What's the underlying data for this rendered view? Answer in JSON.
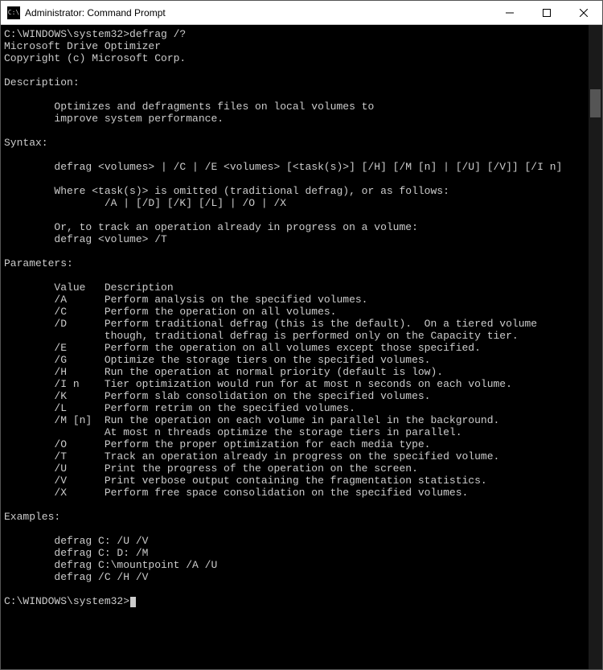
{
  "titlebar": {
    "icon_text": "C:\\",
    "title": "Administrator: Command Prompt"
  },
  "prompt1": "C:\\WINDOWS\\system32>defrag /?",
  "header1": "Microsoft Drive Optimizer",
  "header2": "Copyright (c) Microsoft Corp.",
  "desc_label": "Description:",
  "desc1": "        Optimizes and defragments files on local volumes to",
  "desc2": "        improve system performance.",
  "syntax_label": "Syntax:",
  "syntax1": "        defrag <volumes> | /C | /E <volumes> [<task(s)>] [/H] [/M [n] | [/U] [/V]] [/I n]",
  "syntax2": "        Where <task(s)> is omitted (traditional defrag), or as follows:",
  "syntax3": "                /A | [/D] [/K] [/L] | /O | /X",
  "syntax4": "        Or, to track an operation already in progress on a volume:",
  "syntax5": "        defrag <volume> /T",
  "params_label": "Parameters:",
  "phdr": "        Value   Description",
  "pA": "        /A      Perform analysis on the specified volumes.",
  "pC": "        /C      Perform the operation on all volumes.",
  "pD1": "        /D      Perform traditional defrag (this is the default).  On a tiered volume",
  "pD2": "                though, traditional defrag is performed only on the Capacity tier.",
  "pE": "        /E      Perform the operation on all volumes except those specified.",
  "pG": "        /G      Optimize the storage tiers on the specified volumes.",
  "pH": "        /H      Run the operation at normal priority (default is low).",
  "pIn": "        /I n    Tier optimization would run for at most n seconds on each volume.",
  "pK": "        /K      Perform slab consolidation on the specified volumes.",
  "pL": "        /L      Perform retrim on the specified volumes.",
  "pM1": "        /M [n]  Run the operation on each volume in parallel in the background.",
  "pM2": "                At most n threads optimize the storage tiers in parallel.",
  "pO": "        /O      Perform the proper optimization for each media type.",
  "pT": "        /T      Track an operation already in progress on the specified volume.",
  "pU": "        /U      Print the progress of the operation on the screen.",
  "pV": "        /V      Print verbose output containing the fragmentation statistics.",
  "pX": "        /X      Perform free space consolidation on the specified volumes.",
  "examples_label": "Examples:",
  "ex1": "        defrag C: /U /V",
  "ex2": "        defrag C: D: /M",
  "ex3": "        defrag C:\\mountpoint /A /U",
  "ex4": "        defrag /C /H /V",
  "prompt2": "C:\\WINDOWS\\system32>"
}
